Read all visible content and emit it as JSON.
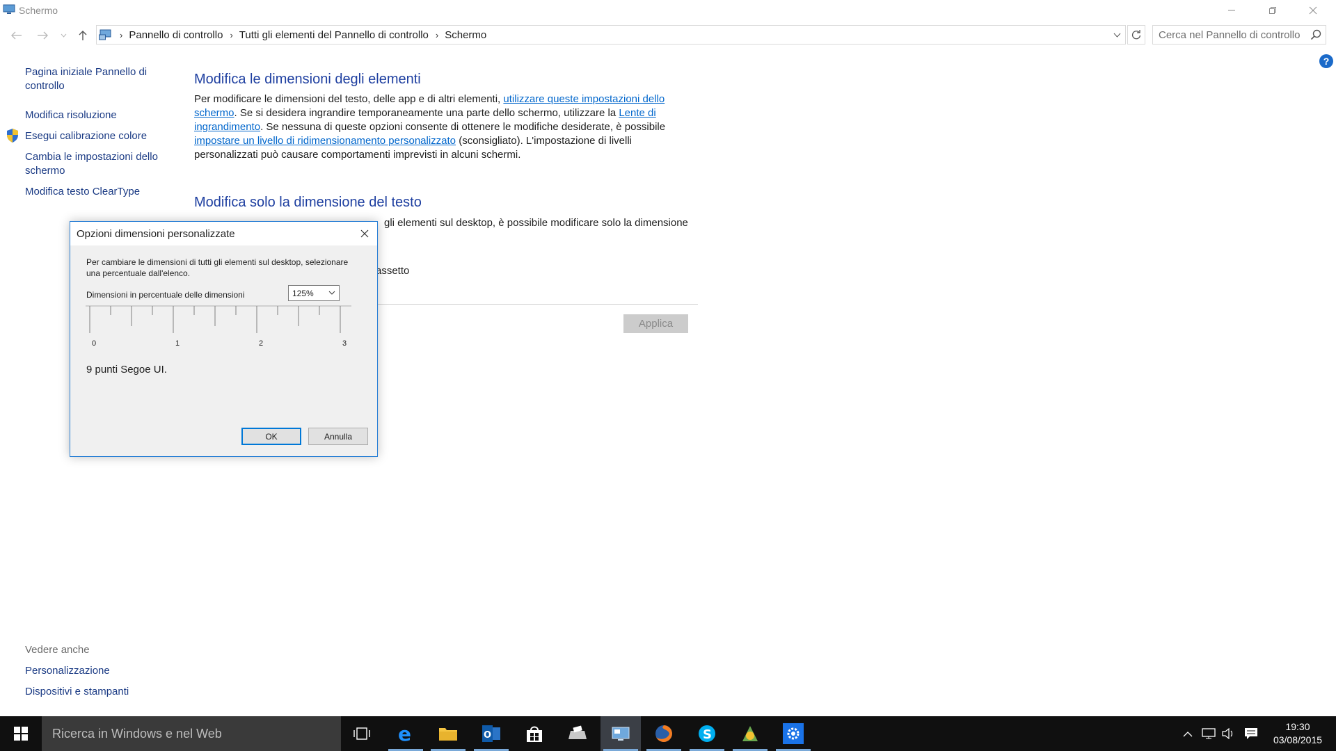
{
  "window": {
    "title": "Schermo"
  },
  "addressbar": {
    "crumbs": [
      "Pannello di controllo",
      "Tutti gli elementi del Pannello di controllo",
      "Schermo"
    ],
    "search_placeholder": "Cerca nel Pannello di controllo"
  },
  "sidebar": {
    "items": [
      {
        "label": "Pagina iniziale Pannello di controllo"
      },
      {
        "label": "Modifica risoluzione"
      },
      {
        "label": "Esegui calibrazione colore"
      },
      {
        "label": "Cambia le impostazioni dello schermo"
      },
      {
        "label": "Modifica testo ClearType"
      }
    ],
    "see_also_title": "Vedere anche",
    "see_also": [
      {
        "label": "Personalizzazione"
      },
      {
        "label": "Dispositivi e stampanti"
      }
    ]
  },
  "main": {
    "section1": {
      "title": "Modifica le dimensioni degli elementi",
      "text_1": "Per modificare le dimensioni del testo, delle app e di altri elementi, ",
      "link_1": "utilizzare queste impostazioni dello schermo",
      "text_2": ". Se si desidera ingrandire temporaneamente una parte dello schermo, utilizzare la ",
      "link_2": "Lente di ingrandimento",
      "text_3": ". Se nessuna di queste opzioni consente di ottenere le modifiche desiderate, è possibile ",
      "link_3": "impostare un livello di ridimensionamento personalizzato",
      "text_4": " (sconsigliato). L'impostazione di livelli personalizzati può causare comportamenti imprevisti in alcuni schermi."
    },
    "section2": {
      "title": "Modifica solo la dimensione del testo",
      "visible_text": "gli elementi sul desktop, è possibile modificare solo la dimensione",
      "visible_text_2": "assetto"
    },
    "apply_label": "Applica"
  },
  "dialog": {
    "title": "Opzioni dimensioni personalizzate",
    "description": "Per cambiare le dimensioni di tutti gli elementi sul desktop, selezionare una percentuale dall'elenco.",
    "scale_label": "Dimensioni in percentuale delle dimensioni",
    "scale_value": "125%",
    "ruler_labels": [
      "0",
      "1",
      "2",
      "3"
    ],
    "font_info": "9 punti Segoe UI.",
    "ok_label": "OK",
    "cancel_label": "Annulla"
  },
  "taskbar": {
    "search_placeholder": "Ricerca in Windows e nel Web",
    "apps": [
      "task-view",
      "edge",
      "file-explorer",
      "outlook",
      "store",
      "fax-scanner",
      "display-control-panel",
      "firefox",
      "skype",
      "app-green",
      "settings"
    ],
    "time": "19:30",
    "date": "03/08/2015"
  },
  "colors": {
    "heading": "#1e3fa0",
    "link": "#0066cc",
    "nav_link": "#1a3a84",
    "taskbar": "#101010",
    "accent": "#0078d7"
  }
}
